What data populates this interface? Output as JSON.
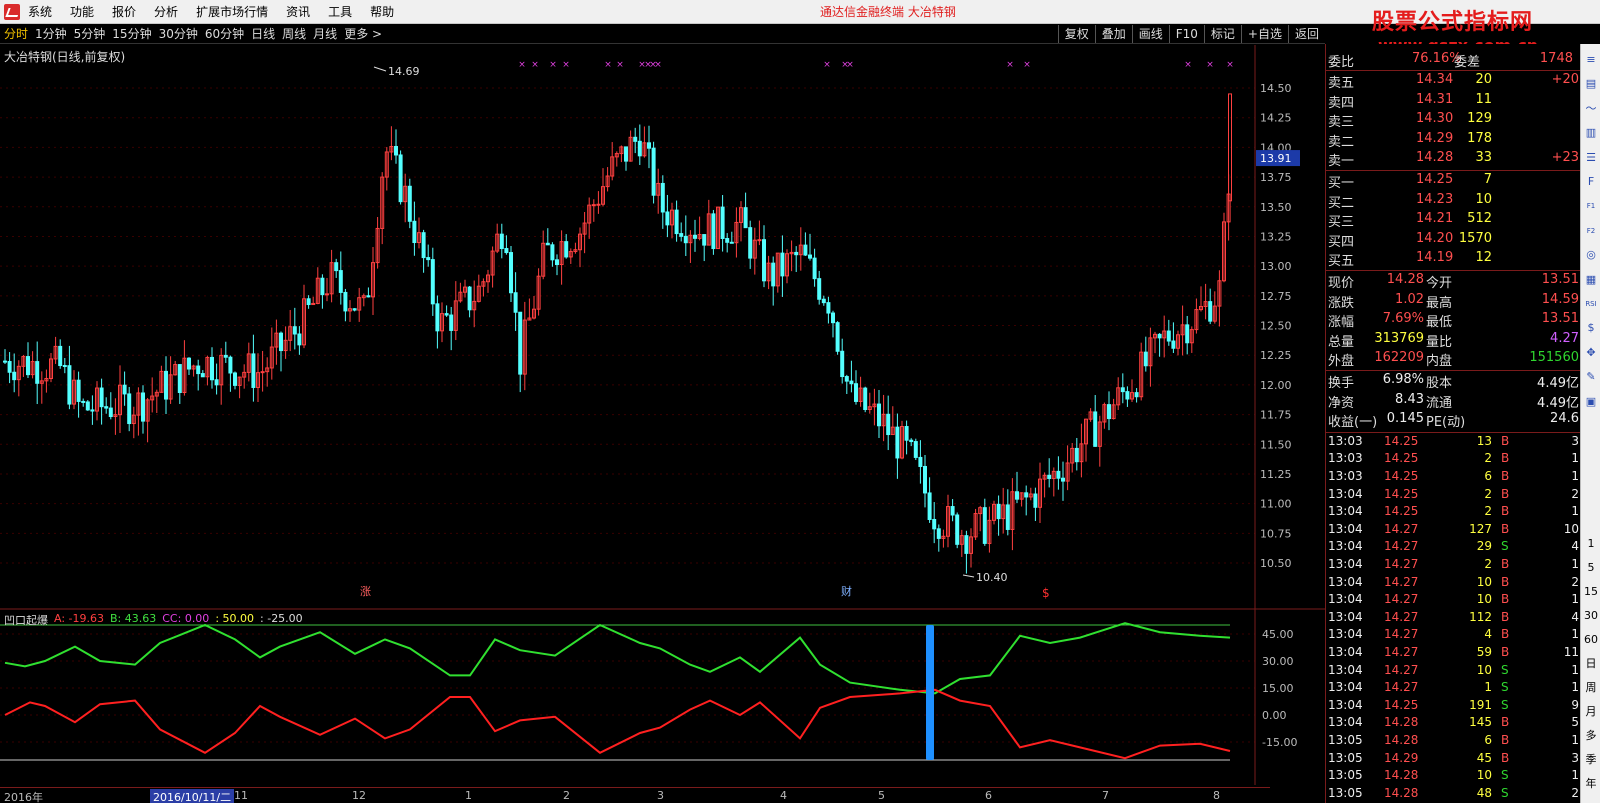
{
  "menu": {
    "items": [
      "系统",
      "功能",
      "报价",
      "分析",
      "扩展市场行情",
      "资讯",
      "工具",
      "帮助"
    ],
    "center_title": "通达信金融终端   大冶特钢"
  },
  "brand": {
    "title": "股票公式指标网",
    "url": "www.gszx.com.cn"
  },
  "periods": {
    "items": [
      "分时",
      "1分钟",
      "5分钟",
      "15分钟",
      "30分钟",
      "60分钟",
      "日线",
      "周线",
      "月线",
      "更多 >"
    ],
    "active": 0
  },
  "tools": [
    "复权",
    "叠加",
    "画线",
    "F10",
    "标记",
    "+自选",
    "返回"
  ],
  "chart": {
    "title": "大冶特钢(日线,前复权)",
    "price_ticks": [
      "14.50",
      "14.25",
      "14.00",
      "13.75",
      "13.50",
      "13.25",
      "13.00",
      "12.75",
      "12.50",
      "12.25",
      "12.00",
      "11.75",
      "11.50",
      "11.25",
      "11.00",
      "10.75",
      "10.50"
    ],
    "current_price_label": "13.91",
    "high_label": "14.69",
    "low_label": "10.40",
    "markers": {
      "zhang": "涨",
      "cai": "财",
      "dollar": "$"
    },
    "colors": {
      "up": "#ff4040",
      "down": "#54ffff",
      "marks": "#e040e0"
    }
  },
  "indicator": {
    "name": "凹口起爆",
    "legend": [
      {
        "text": "A: -19.63",
        "color": "#ff4040"
      },
      {
        "text": "B: 43.63",
        "color": "#40e040"
      },
      {
        "text": "CC: 0.00",
        "color": "#e040e0"
      },
      {
        "text": ": 50.00",
        "color": "#ffff40"
      },
      {
        "text": ": -25.00",
        "color": "#dddddd"
      }
    ],
    "ticks": [
      "45.00",
      "30.00",
      "15.00",
      "0.00",
      "-15.00"
    ],
    "colors": {
      "a": "#ff2020",
      "b": "#30e030",
      "signal": "#1e90ff",
      "upper": "#40c040",
      "lower": "#cccccc"
    }
  },
  "xaxis": {
    "labels": [
      "2016年",
      "2016/10/11/二",
      "11",
      "12",
      "1",
      "2",
      "3",
      "4",
      "5",
      "6",
      "7",
      "8"
    ]
  },
  "quote": {
    "weibi": {
      "label": "委比",
      "value": "76.16%",
      "label2": "委差",
      "value2": "1748"
    },
    "asks": [
      {
        "label": "卖五",
        "price": "14.34",
        "vol": "20",
        "chg": "+20"
      },
      {
        "label": "卖四",
        "price": "14.31",
        "vol": "11",
        "chg": ""
      },
      {
        "label": "卖三",
        "price": "14.30",
        "vol": "129",
        "chg": ""
      },
      {
        "label": "卖二",
        "price": "14.29",
        "vol": "178",
        "chg": ""
      },
      {
        "label": "卖一",
        "price": "14.28",
        "vol": "33",
        "chg": "+23"
      }
    ],
    "bids": [
      {
        "label": "买一",
        "price": "14.25",
        "vol": "7"
      },
      {
        "label": "买二",
        "price": "14.23",
        "vol": "10"
      },
      {
        "label": "买三",
        "price": "14.21",
        "vol": "512"
      },
      {
        "label": "买四",
        "price": "14.20",
        "vol": "1570"
      },
      {
        "label": "买五",
        "price": "14.19",
        "vol": "12"
      }
    ],
    "stats": [
      {
        "l1": "现价",
        "v1": "14.28",
        "c1": "red",
        "l2": "今开",
        "v2": "13.51",
        "c2": "red"
      },
      {
        "l1": "涨跌",
        "v1": "1.02",
        "c1": "red",
        "l2": "最高",
        "v2": "14.59",
        "c2": "red"
      },
      {
        "l1": "涨幅",
        "v1": "7.69%",
        "c1": "red",
        "l2": "最低",
        "v2": "13.51",
        "c2": "red"
      },
      {
        "l1": "总量",
        "v1": "313769",
        "c1": "yellow",
        "l2": "量比",
        "v2": "4.27",
        "c2": "purple"
      },
      {
        "l1": "外盘",
        "v1": "162209",
        "c1": "red",
        "l2": "内盘",
        "v2": "151560",
        "c2": "green"
      }
    ],
    "fund": [
      {
        "l1": "换手",
        "v1": "6.98%",
        "l2": "股本",
        "v2": "4.49亿"
      },
      {
        "l1": "净资",
        "v1": "8.43",
        "l2": "流通",
        "v2": "4.49亿"
      },
      {
        "l1": "收益(一)",
        "v1": "0.145",
        "l2": "PE(动)",
        "v2": "24.6"
      }
    ]
  },
  "ticks": [
    {
      "time": "13:03",
      "price": "14.25",
      "vol": "13",
      "side": "B",
      "n": "3"
    },
    {
      "time": "13:03",
      "price": "14.25",
      "vol": "2",
      "side": "B",
      "n": "1"
    },
    {
      "time": "13:03",
      "price": "14.25",
      "vol": "6",
      "side": "B",
      "n": "1"
    },
    {
      "time": "13:04",
      "price": "14.25",
      "vol": "2",
      "side": "B",
      "n": "2"
    },
    {
      "time": "13:04",
      "price": "14.25",
      "vol": "2",
      "side": "B",
      "n": "1"
    },
    {
      "time": "13:04",
      "price": "14.27",
      "vol": "127",
      "side": "B",
      "n": "10"
    },
    {
      "time": "13:04",
      "price": "14.27",
      "vol": "29",
      "side": "S",
      "n": "4"
    },
    {
      "time": "13:04",
      "price": "14.27",
      "vol": "2",
      "side": "B",
      "n": "1"
    },
    {
      "time": "13:04",
      "price": "14.27",
      "vol": "10",
      "side": "B",
      "n": "2"
    },
    {
      "time": "13:04",
      "price": "14.27",
      "vol": "10",
      "side": "B",
      "n": "1"
    },
    {
      "time": "13:04",
      "price": "14.27",
      "vol": "112",
      "side": "B",
      "n": "4"
    },
    {
      "time": "13:04",
      "price": "14.27",
      "vol": "4",
      "side": "B",
      "n": "1"
    },
    {
      "time": "13:04",
      "price": "14.27",
      "vol": "59",
      "side": "B",
      "n": "11"
    },
    {
      "time": "13:04",
      "price": "14.27",
      "vol": "10",
      "side": "S",
      "n": "1"
    },
    {
      "time": "13:04",
      "price": "14.27",
      "vol": "1",
      "side": "S",
      "n": "1"
    },
    {
      "time": "13:04",
      "price": "14.25",
      "vol": "191",
      "side": "S",
      "n": "9"
    },
    {
      "time": "13:04",
      "price": "14.28",
      "vol": "145",
      "side": "B",
      "n": "5"
    },
    {
      "time": "13:05",
      "price": "14.28",
      "vol": "6",
      "side": "B",
      "n": "1"
    },
    {
      "time": "13:05",
      "price": "14.29",
      "vol": "45",
      "side": "B",
      "n": "3"
    },
    {
      "time": "13:05",
      "price": "14.28",
      "vol": "10",
      "side": "S",
      "n": "1"
    },
    {
      "time": "13:05",
      "price": "14.28",
      "vol": "48",
      "side": "S",
      "n": "2"
    }
  ],
  "sidetools": {
    "icons": [
      "menu-icon",
      "bars-icon",
      "minute-chart-icon",
      "kline-icon",
      "list-icon",
      "f10-icon",
      "f1-icon",
      "f2-icon",
      "compass-icon",
      "vol-icon",
      "rsi-icon",
      "stock-icon",
      "move-icon",
      "pen-icon",
      "calc-icon"
    ],
    "labels": [
      "1",
      "5",
      "15",
      "30",
      "60",
      "日",
      "周",
      "月",
      "多",
      "季",
      "年"
    ]
  }
}
